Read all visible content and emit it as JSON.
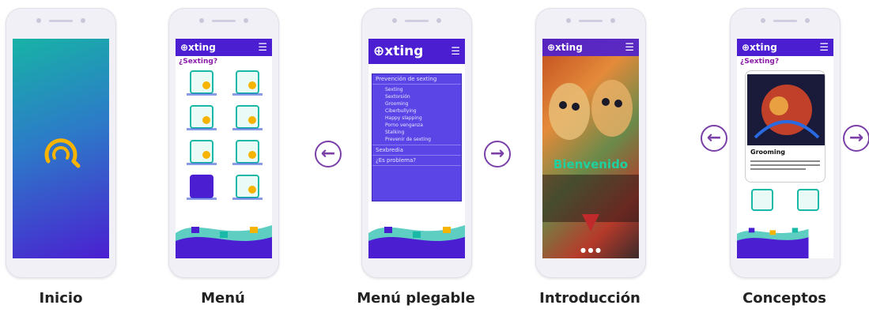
{
  "screens": [
    {
      "caption": "Inicio"
    },
    {
      "caption": "Menú",
      "logo": "⊕xting",
      "subtitle": "¿Sexting?"
    },
    {
      "caption": "Menú plegable",
      "logo": "⊕xting"
    },
    {
      "caption": "Introducción",
      "logo": "⊕xting",
      "overlay": "Bienvenido"
    },
    {
      "caption": "Conceptos",
      "logo": "⊕xting",
      "subtitle": "¿Sexting?",
      "card_title": "Grooming"
    }
  ],
  "menu": {
    "section1": "Prevención de sexting",
    "items": [
      "Sexting",
      "Sextorsión",
      "Grooming",
      "Ciberbullying",
      "Happy slapping",
      "Porno venganza",
      "Stalking",
      "Prevenir de sexting"
    ],
    "section2": "Sexbredia",
    "section3": "¿Es problema?"
  },
  "arrows": {
    "left": "←",
    "right": "→"
  },
  "colors": {
    "accent": "#4b1fd1",
    "teal": "#19b9a8",
    "arrow": "#7b3fa8"
  }
}
